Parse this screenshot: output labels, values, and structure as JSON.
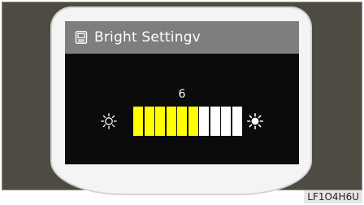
{
  "osd": {
    "title": "Bright Settingv",
    "title_icon": "monitor-menu-icon",
    "value": "6",
    "brightness": {
      "current": 6,
      "max": 10,
      "filled_color": "#ffff00",
      "empty_color": "#ffffff"
    },
    "min_icon": "sun-dim-icon",
    "max_icon": "sun-bright-icon"
  },
  "caption": "LF1O4H6U",
  "colors": {
    "titlebar": "#7e7e80",
    "screen": "#0b0b0b",
    "housing": "#4d4b42",
    "bezel": "#f4f4f4"
  }
}
